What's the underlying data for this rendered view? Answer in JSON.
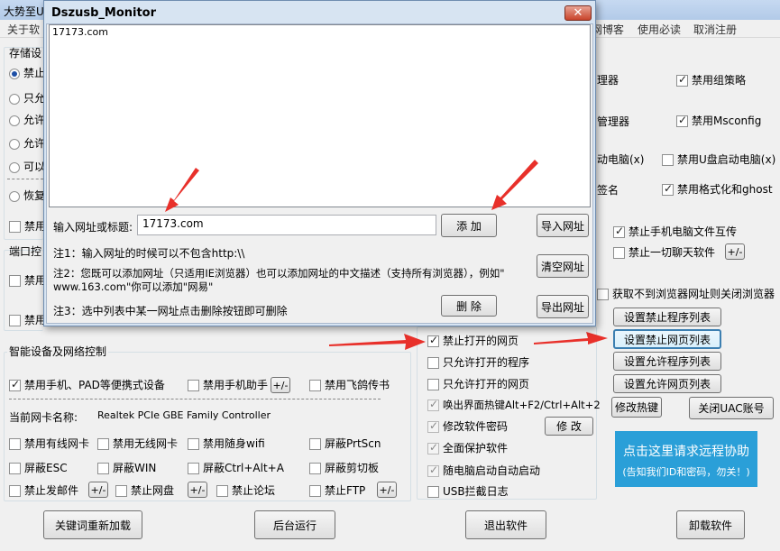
{
  "main_window": {
    "title": "大势至U",
    "menu": [
      "关于软",
      "网博客",
      "使用必读",
      "取消注册"
    ]
  },
  "dialog": {
    "title": "Dszusb_Monitor",
    "close": "✕",
    "list_items": [
      "17173.com"
    ],
    "input_label": "输入网址或标题:",
    "input_value": "17173.com",
    "add_button": "添 加",
    "import_button": "导入网址",
    "clear_button": "清空网址",
    "delete_button": "删 除",
    "export_button": "导出网址",
    "note1": "注1：输入网址的时候可以不包含http:\\\\",
    "note2_line1": "注2：您既可以添加网址（只适用IE浏览器）也可以添加网址的中文描述（支持所有浏览器），例如\"",
    "note2_line2": "www.163.com\"你可以添加\"网易\"",
    "note3": "注3：选中列表中某一网址点击删除按钮即可删除"
  },
  "storage": {
    "title": "存储设",
    "radios": [
      {
        "label": "禁止",
        "checked": true
      },
      {
        "label": "只允",
        "checked": false
      },
      {
        "label": "允许",
        "checked": false
      },
      {
        "label": "允许",
        "checked": false
      },
      {
        "label": "可以",
        "checked": false
      },
      {
        "label": "恢复",
        "checked": false
      }
    ],
    "disable_label": "禁用"
  },
  "port_control": {
    "title": "端口控",
    "item1": "禁用",
    "item2": "禁用"
  },
  "right_top": {
    "item1_partial": "理器",
    "item2_partial": "管理器",
    "item3_partial": "动电脑(x)",
    "item4_partial": "签名",
    "group_policy": "禁用组策略",
    "msconfig": "禁用Msconfig",
    "usb_boot": "禁用U盘启动电脑(x)",
    "format_ghost": "禁用格式化和ghost"
  },
  "right_mid": {
    "phone_file": "禁止手机电脑文件互传",
    "all_chat": "禁止一切聊天软件",
    "plus_minus": "+/-",
    "close_browser": "获取不到浏览器网址则关闭浏览器",
    "set_forbid_program": "设置禁止程序列表",
    "set_forbid_web": "设置禁止网页列表",
    "set_allow_program": "设置允许程序列表",
    "set_allow_web": "设置允许网页列表",
    "modify_hotkey": "修改热键",
    "close_uac": "关闭UAC账号"
  },
  "web_options": {
    "forbid_web": "禁止打开的网页",
    "allow_program": "只允许打开的程序",
    "allow_web": "只允许打开的网页",
    "hotkey": "唤出界面热键Alt+F2/Ctrl+Alt+2",
    "modify_password": "修改软件密码",
    "modify_btn": "修 改",
    "full_protect": "全面保护软件",
    "autostart": "随电脑启动自动启动",
    "usb_log": "USB拦截日志"
  },
  "smart_device": {
    "title": "智能设备及网络控制",
    "mobile_device": "禁用手机、PAD等便携式设备",
    "phone_assistant": "禁用手机助手",
    "flying_pigeon": "禁用飞鸽传书",
    "plus_minus": "+/-",
    "nic_label": "当前网卡名称:",
    "nic_name": "Realtek PCIe GBE Family Controller",
    "wired": "禁用有线网卡",
    "wireless": "禁用无线网卡",
    "portable_wifi": "禁用随身wifi",
    "prtscn": "屏蔽PrtScn",
    "esc": "屏蔽ESC",
    "win": "屏蔽WIN",
    "ctrl_alt_a": "屏蔽Ctrl+Alt+A",
    "clipboard": "屏蔽剪切板",
    "email": "禁止发邮件",
    "netdisk": "禁止网盘",
    "forum": "禁止论坛",
    "ftp": "禁止FTP"
  },
  "promo": {
    "line1": "点击这里请求远程协助",
    "line2": "(告知我们ID和密码，勿关！)"
  },
  "bottom": {
    "reload": "关键词重新加载",
    "background": "后台运行",
    "exit": "退出软件",
    "uninstall": "卸载软件"
  },
  "colors": {
    "arrow": "#e8302a",
    "promo_bg": "#2a9fd8"
  }
}
